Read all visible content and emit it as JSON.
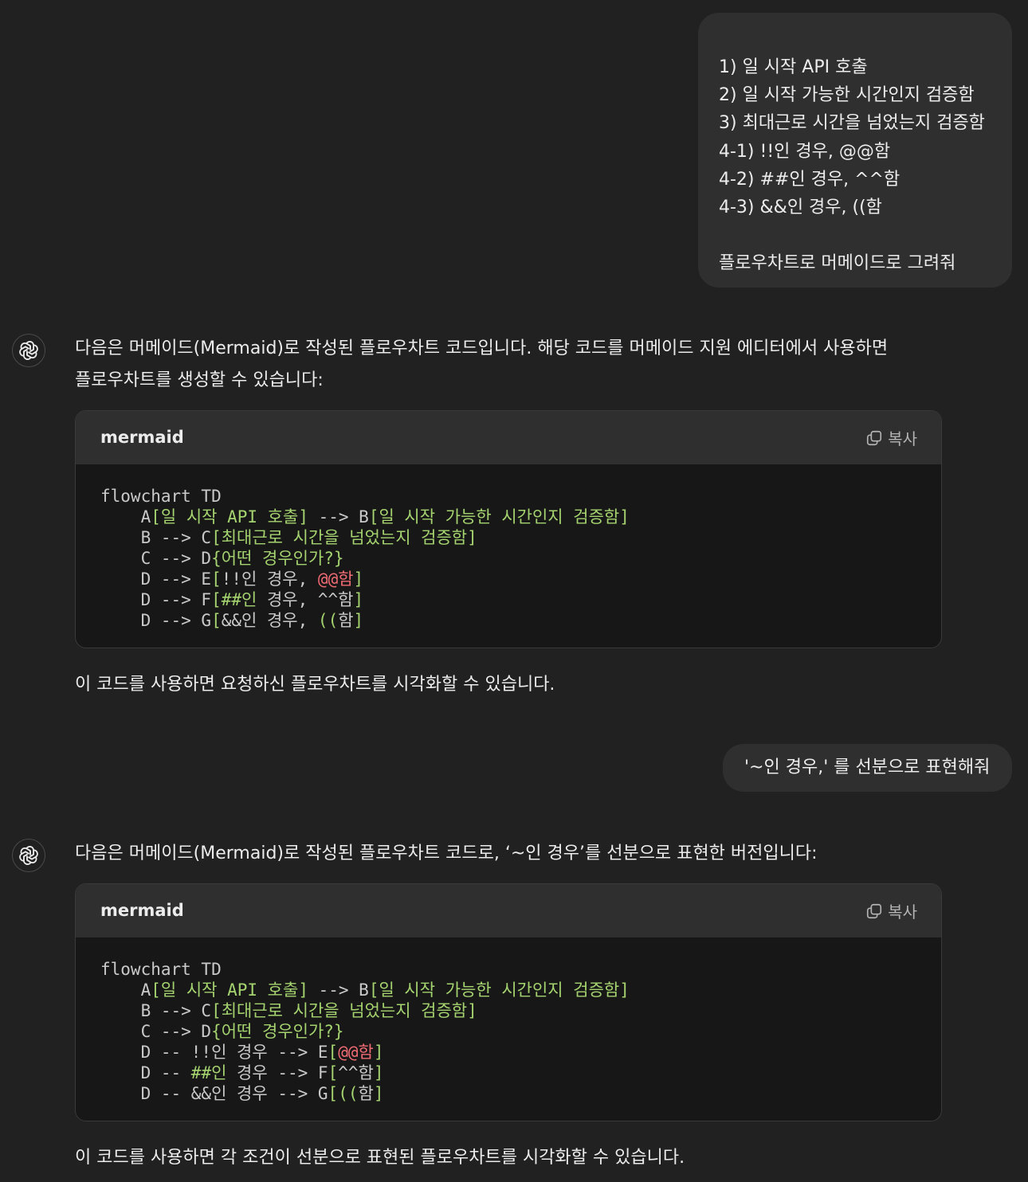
{
  "user_messages": [
    {
      "lines": [
        "1) 일 시작 API 호출",
        "2) 일 시작 가능한 시간인지 검증함",
        "3) 최대근로 시간을 넘었는지 검증함",
        "4-1) !!인 경우, @@함",
        "4-2) ##인 경우, ^^함",
        "4-3) &&인 경우, ((함",
        "",
        "플로우차트로 머메이드로 그려줘"
      ]
    },
    {
      "text": "'~인 경우,' 를 선분으로 표현해줘"
    }
  ],
  "assistant_messages": [
    {
      "intro_line1": "다음은 머메이드(Mermaid)로 작성된 플로우차트 코드입니다. 해당 코드를 머메이드 지원 에디터에서 사용하면",
      "intro_line2": "플로우차트를 생성할 수 있습니다:",
      "code_lang": "mermaid",
      "copy_label": "복사",
      "outro": "이 코드를 사용하면 요청하신 플로우차트를 시각화할 수 있습니다.",
      "code": [
        {
          "p1": "flowchart TD"
        },
        {
          "p1": "    A",
          "g1": "[일 시작 API 호출]",
          "p2": " --> B",
          "g2": "[일 시작 가능한 시간인지 검증함]"
        },
        {
          "p1": "    B --> C",
          "g1": "[최대근로 시간을 넘었는지 검증함]"
        },
        {
          "p1": "    C --> D",
          "g1": "{어떤 경우인가?}"
        },
        {
          "p1": "    D --> E",
          "g1": "[",
          "p2": "!!인 경우, ",
          "r1": "@@함",
          "g2": "]"
        },
        {
          "p1": "    D --> F",
          "g1": "[##인",
          "p2": " 경우, ^^함",
          "g2": "]"
        },
        {
          "p1": "    D --> G",
          "g1": "[",
          "p2": "&&인 경우, ",
          "g2": "((",
          "p3": "함",
          "g3": "]"
        }
      ]
    },
    {
      "intro_line1": "다음은 머메이드(Mermaid)로 작성된 플로우차트 코드로, ‘~인 경우’를 선분으로 표현한 버전입니다:",
      "code_lang": "mermaid",
      "copy_label": "복사",
      "outro": "이 코드를 사용하면 각 조건이 선분으로 표현된 플로우차트를 시각화할 수 있습니다.",
      "code": [
        {
          "p1": "flowchart TD"
        },
        {
          "p1": "    A",
          "g1": "[일 시작 API 호출]",
          "p2": " --> B",
          "g2": "[일 시작 가능한 시간인지 검증함]"
        },
        {
          "p1": "    B --> C",
          "g1": "[최대근로 시간을 넘었는지 검증함]"
        },
        {
          "p1": "    C --> D",
          "g1": "{어떤 경우인가?}"
        },
        {
          "p1": "    D -- !!인 경우 --> E",
          "g1": "[",
          "r1": "@@함",
          "g2": "]"
        },
        {
          "p1": "    D -- ",
          "g1": "##인",
          "p2": " 경우 --> F",
          "g2": "[",
          "p3": "^^함",
          "g3": "]"
        },
        {
          "p1": "    D -- &&인 경우 --> G",
          "g1": "[((",
          "p2": "함",
          "g2": "]"
        }
      ]
    }
  ],
  "colors": {
    "background": "#212121",
    "bubble": "#2f2f2f",
    "code_bg": "#171717",
    "code_green": "#a5d36f",
    "code_red": "#ef6b73"
  }
}
